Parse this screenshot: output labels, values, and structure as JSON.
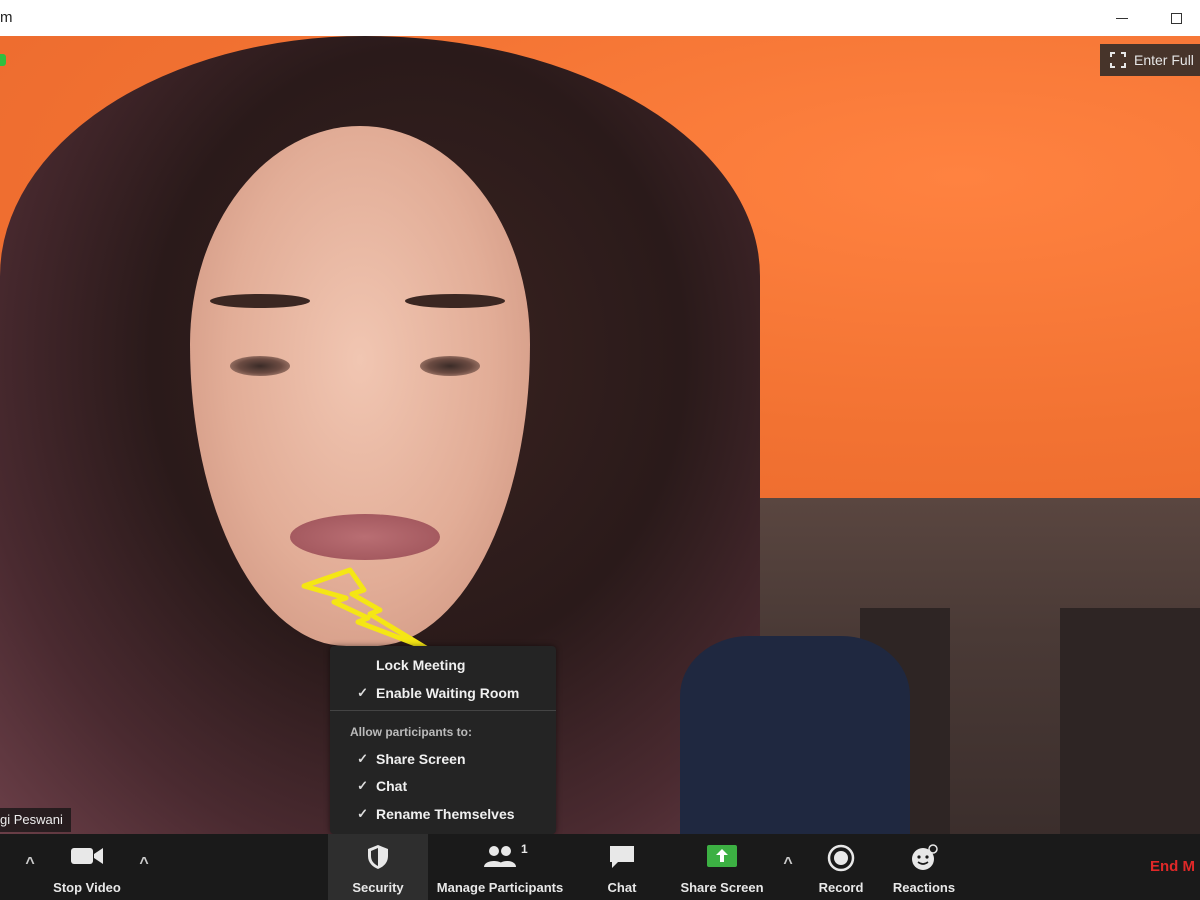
{
  "window": {
    "title_fragment": "m"
  },
  "video": {
    "fullscreen_label": "Enter Full",
    "participant_name": "gi Peswani"
  },
  "security_popup": {
    "items": [
      {
        "label": "Lock Meeting",
        "checked": false
      },
      {
        "label": "Enable Waiting Room",
        "checked": true
      }
    ],
    "section_title": "Allow participants to:",
    "permissions": [
      {
        "label": "Share Screen",
        "checked": true
      },
      {
        "label": "Chat",
        "checked": true
      },
      {
        "label": "Rename Themselves",
        "checked": true
      }
    ],
    "check_glyph": "✓"
  },
  "toolbar": {
    "stop_video": "Stop Video",
    "security": "Security",
    "manage_participants": "Manage Participants",
    "participant_count": "1",
    "chat": "Chat",
    "share_screen": "Share Screen",
    "record": "Record",
    "reactions": "Reactions",
    "end_meeting": "End M",
    "caret": "^"
  },
  "colors": {
    "toolbar_bg": "#1a1a1a",
    "share_screen_green": "#3cb043",
    "end_meeting_red": "#e02828",
    "annotation_yellow": "#f5e614"
  }
}
